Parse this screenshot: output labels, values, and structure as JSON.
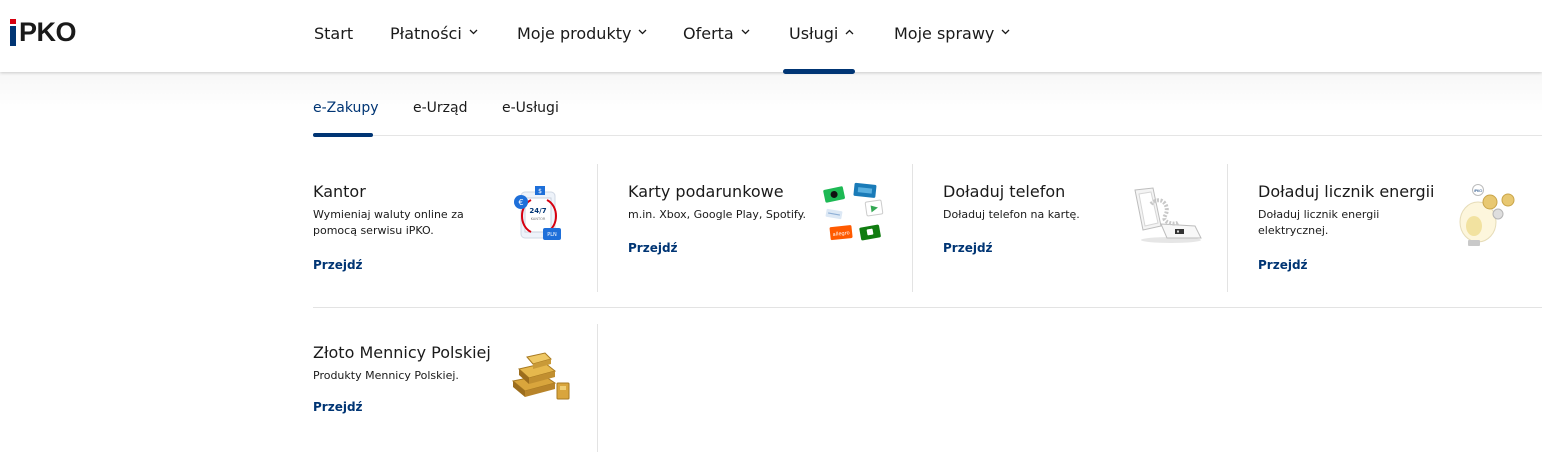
{
  "logo": {
    "text": "PKO",
    "accent_color": "#d7000f",
    "brand_color": "#003574"
  },
  "nav": {
    "items": [
      {
        "label": "Start",
        "has_chevron": false
      },
      {
        "label": "Płatności",
        "has_chevron": true
      },
      {
        "label": "Moje produkty",
        "has_chevron": true
      },
      {
        "label": "Oferta",
        "has_chevron": true
      },
      {
        "label": "Usługi",
        "has_chevron": true,
        "expanded": true
      },
      {
        "label": "Moje sprawy",
        "has_chevron": true
      }
    ]
  },
  "subtabs": [
    {
      "label": "e-Zakupy",
      "active": true
    },
    {
      "label": "e-Urząd"
    },
    {
      "label": "e-Usługi"
    }
  ],
  "cards": [
    {
      "title": "Kantor",
      "description": "Wymieniaj waluty online za pomocą serwisu iPKO.",
      "link": "Przejdź",
      "icon": "currency-exchange-icon"
    },
    {
      "title": "Karty podarunkowe",
      "description": "m.in. Xbox, Google Play, Spotify.",
      "link": "Przejdź",
      "icon": "gift-cards-icon"
    },
    {
      "title": "Doładuj telefon",
      "description": "Doładuj telefon na kartę.",
      "link": "Przejdź",
      "icon": "phone-topup-icon"
    },
    {
      "title": "Doładuj licznik energii",
      "description": "Doładuj licznik energii elektrycznej.",
      "link": "Przejdź",
      "icon": "energy-meter-icon"
    },
    {
      "title": "Złoto Mennicy Polskiej",
      "description": "Produkty Mennicy Polskiej.",
      "link": "Przejdź",
      "icon": "gold-bars-icon"
    }
  ],
  "icon_texts": {
    "kantor_badge": "24/7",
    "kantor_small": "KANTOR",
    "kantor_pln": "PLN",
    "allegro": "allegro",
    "meter": "iPKO"
  }
}
